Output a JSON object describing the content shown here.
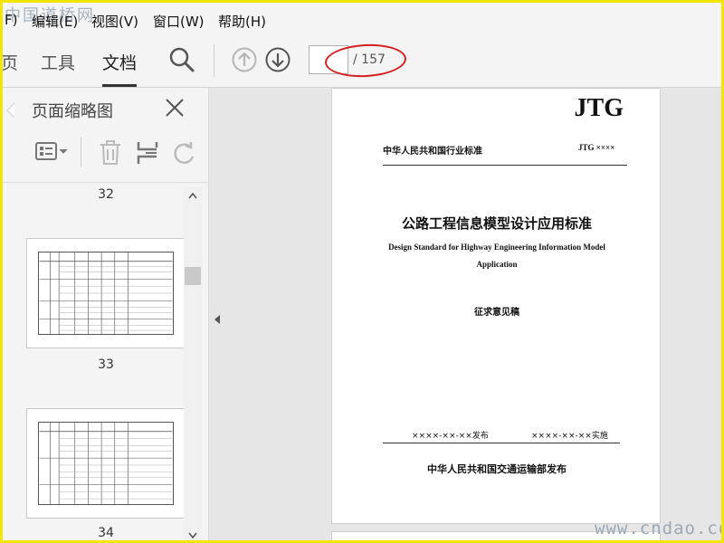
{
  "watermark_top": "中国道桥网",
  "watermark_bottom": "www.cndao.com",
  "menu": {
    "items": [
      "F)",
      "编辑(E)",
      "视图(V)",
      "窗口(W)",
      "帮助(H)"
    ]
  },
  "toolbar": {
    "tabs": [
      "页",
      "工具",
      "文档"
    ],
    "active_tab": "文档",
    "page_current": "",
    "page_total": "/ 157",
    "icons": [
      "search-icon",
      "page-up-icon",
      "page-down-icon"
    ]
  },
  "thumbnail_panel": {
    "title": "页面缩略图",
    "tool_icons": [
      "thumbnail-options-icon",
      "trash-icon",
      "extract-pages-icon",
      "rotate-icon"
    ],
    "pages": [
      "32",
      "33",
      "34"
    ]
  },
  "document": {
    "logo": "JTG",
    "header_left": "中华人民共和国行业标准",
    "header_right": "JTG ××××",
    "title_cn": "公路工程信息模型设计应用标准",
    "title_en_line1": "Design Standard for Highway Engineering Information Model",
    "title_en_line2": "Application",
    "draft_label": "征求意见稿",
    "publish_date": "××××-××-××发布",
    "effective_date": "××××-××-××实施",
    "publisher": "中华人民共和国交通运输部发布"
  },
  "colors": {
    "frame_border": "#f2e600",
    "highlight_oval": "#d42020"
  }
}
